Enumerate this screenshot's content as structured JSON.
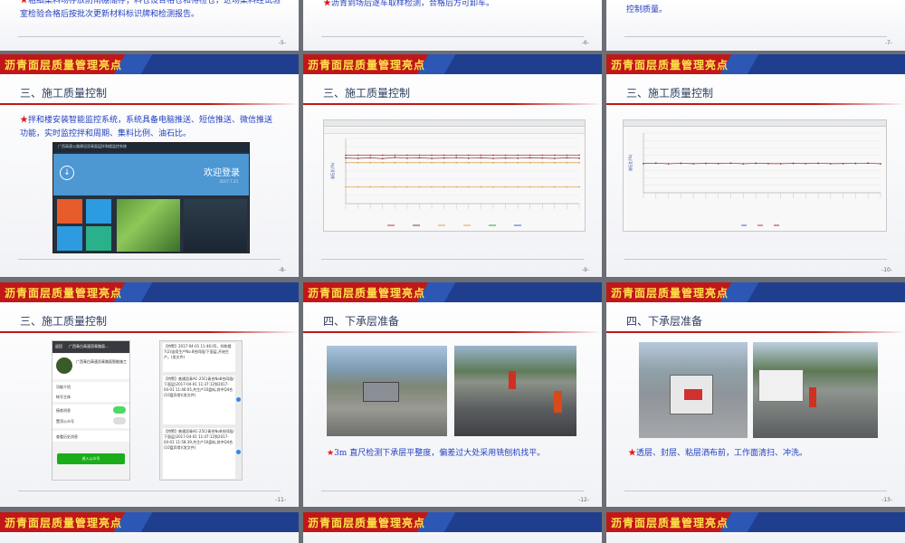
{
  "header_title": "沥青面层质量管理亮点",
  "top_row": {
    "s5_text": "粗细集料场存放防雨棚储存；料仓设合格仓和待检仓，进场集料经试验室检验合格后按批次更新材料标识牌和检测报告。",
    "s6_text": "沥青到场后逐车取样检测，合格后方可卸车。",
    "s7_text": "控制质量。",
    "p5": "-5-",
    "p6": "-6-",
    "p7": "-7-"
  },
  "slide8": {
    "section": "三、施工质量控制",
    "text": "拌和楼安装智能监控系统，系统具备电脑推送、短信推送、微信推送功能，实时监控拌和周期、集料比例、油石比。",
    "login_title": "欢迎登录",
    "login_date": "2017.7.25",
    "system_title": "广西高速公路建设沥青面层拌和楼监控系统",
    "page": "-8-"
  },
  "slide9": {
    "section": "三、施工质量控制",
    "page": "-9-",
    "ylabel": "油石比(%)"
  },
  "slide10": {
    "section": "三、施工质量控制",
    "page": "-10-",
    "ylabel": "油石比(%)"
  },
  "slide11": {
    "section": "三、施工质量控制",
    "page": "-11-",
    "phone_back": "返回",
    "phone_title": "广西青白高速沥青路面...",
    "account_name": "广西青白高速沥青路面智能施工",
    "rows": [
      "功能介绍",
      "帐号主体",
      "接收消息",
      "置顶公众号",
      "查看历史消息"
    ],
    "enter_btn": "进入公众号",
    "msgs": [
      "【特警】2017-04-01 11:46:05，拌和楼7(2)连续生产No.8合同段/下面层,开始生产。(发文件)",
      "【特警】普通沥青AC-25C(青合No8合同段/下面层)2017-04-01 11:37:12到2017-04-01 11:46:05,共生产10盘料,其中Q4合(10盘异常)(发文件)",
      "【特警】普通沥青AC-25C(青合No8合同段/下面层)2017-04-01 11:47:12到2017-04-01 11:58:39,共生产10盘料,其中Q4合(10盘异常)(发文件)"
    ]
  },
  "slide12": {
    "section": "四、下承层准备",
    "text": "3m 直尺检测下承层平整度，偏差过大处采用铣刨机找平。",
    "page": "-12-"
  },
  "slide13": {
    "section": "四、下承层准备",
    "text": "透层、封层、粘层洒布前，工作面清扫、冲洗。",
    "page": "-13-"
  },
  "chart_data": [
    {
      "type": "line",
      "title": "",
      "ylabel": "油石比(%)",
      "ylim": [
        0,
        35
      ],
      "series": [
        {
          "values": [
            26,
            26,
            26,
            26,
            26,
            26,
            26,
            26,
            26,
            26,
            26,
            26,
            26,
            26,
            26,
            26,
            26,
            26,
            26,
            26
          ]
        },
        {
          "values": [
            24.5,
            24.3,
            24.6,
            24.2,
            24.8,
            24.4,
            24.6,
            24.3,
            24.5,
            24.7,
            24.4,
            24.6,
            24.3,
            24.5,
            24.4,
            24.6,
            24.5,
            24.3,
            24.6,
            24.4
          ]
        },
        {
          "values": [
            22,
            22,
            22,
            22,
            22,
            22,
            22,
            22,
            22,
            22,
            22,
            22,
            22,
            22,
            22,
            22,
            22,
            22,
            22,
            22
          ]
        },
        {
          "values": [
            9,
            9,
            9,
            9,
            9,
            9,
            9,
            9,
            9,
            9,
            9,
            9,
            9,
            9,
            9,
            9,
            9,
            9,
            9,
            9
          ]
        }
      ]
    },
    {
      "type": "line",
      "title": "",
      "ylabel": "油石比(%)",
      "ylim": [
        0,
        45
      ],
      "series": [
        {
          "values": [
            22,
            22.3,
            21.8,
            22.2,
            21.9,
            22.1,
            22,
            22.3,
            21.8,
            22.2,
            22,
            21.9,
            22.1,
            22,
            22.2,
            21.9,
            22,
            22.1,
            22.3,
            21.8
          ]
        }
      ]
    }
  ]
}
